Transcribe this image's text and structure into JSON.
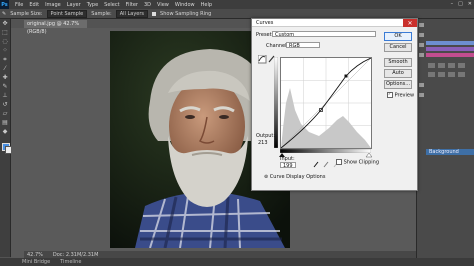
{
  "menubar": {
    "logo": "Ps",
    "items": [
      "File",
      "Edit",
      "Image",
      "Layer",
      "Type",
      "Select",
      "Filter",
      "3D",
      "View",
      "Window",
      "Help"
    ]
  },
  "optbar": {
    "sample_size": "Sample Size:",
    "sample_value": "Point Sample",
    "sample_label": "Sample:",
    "sample_layer": "All Layers",
    "show_ring": "Show Sampling Ring"
  },
  "document": {
    "tab": "original.jpg @ 42.7% (RGB/8)",
    "zoom": "42.7%",
    "doc_size": "Doc: 2.31M/2.31M"
  },
  "bottom_tabs": [
    "Mini Bridge",
    "Timeline"
  ],
  "layers": {
    "selected": "Background"
  },
  "dialog": {
    "title": "Curves",
    "preset_label": "Preset:",
    "preset_value": "Custom",
    "channel_label": "Channel:",
    "channel_value": "RGB",
    "output_label": "Output:",
    "output_value": "213",
    "input_label": "Input:",
    "input_value": "199",
    "show_clipping": "Show Clipping",
    "display_options": "Curve Display Options",
    "buttons": {
      "ok": "OK",
      "cancel": "Cancel",
      "smooth": "Smooth",
      "auto": "Auto",
      "options": "Options..."
    },
    "preview": "Preview"
  },
  "colors": {
    "accent": "#3a7bd5",
    "close": "#c9302c",
    "histogram": "#c8c8c8"
  }
}
